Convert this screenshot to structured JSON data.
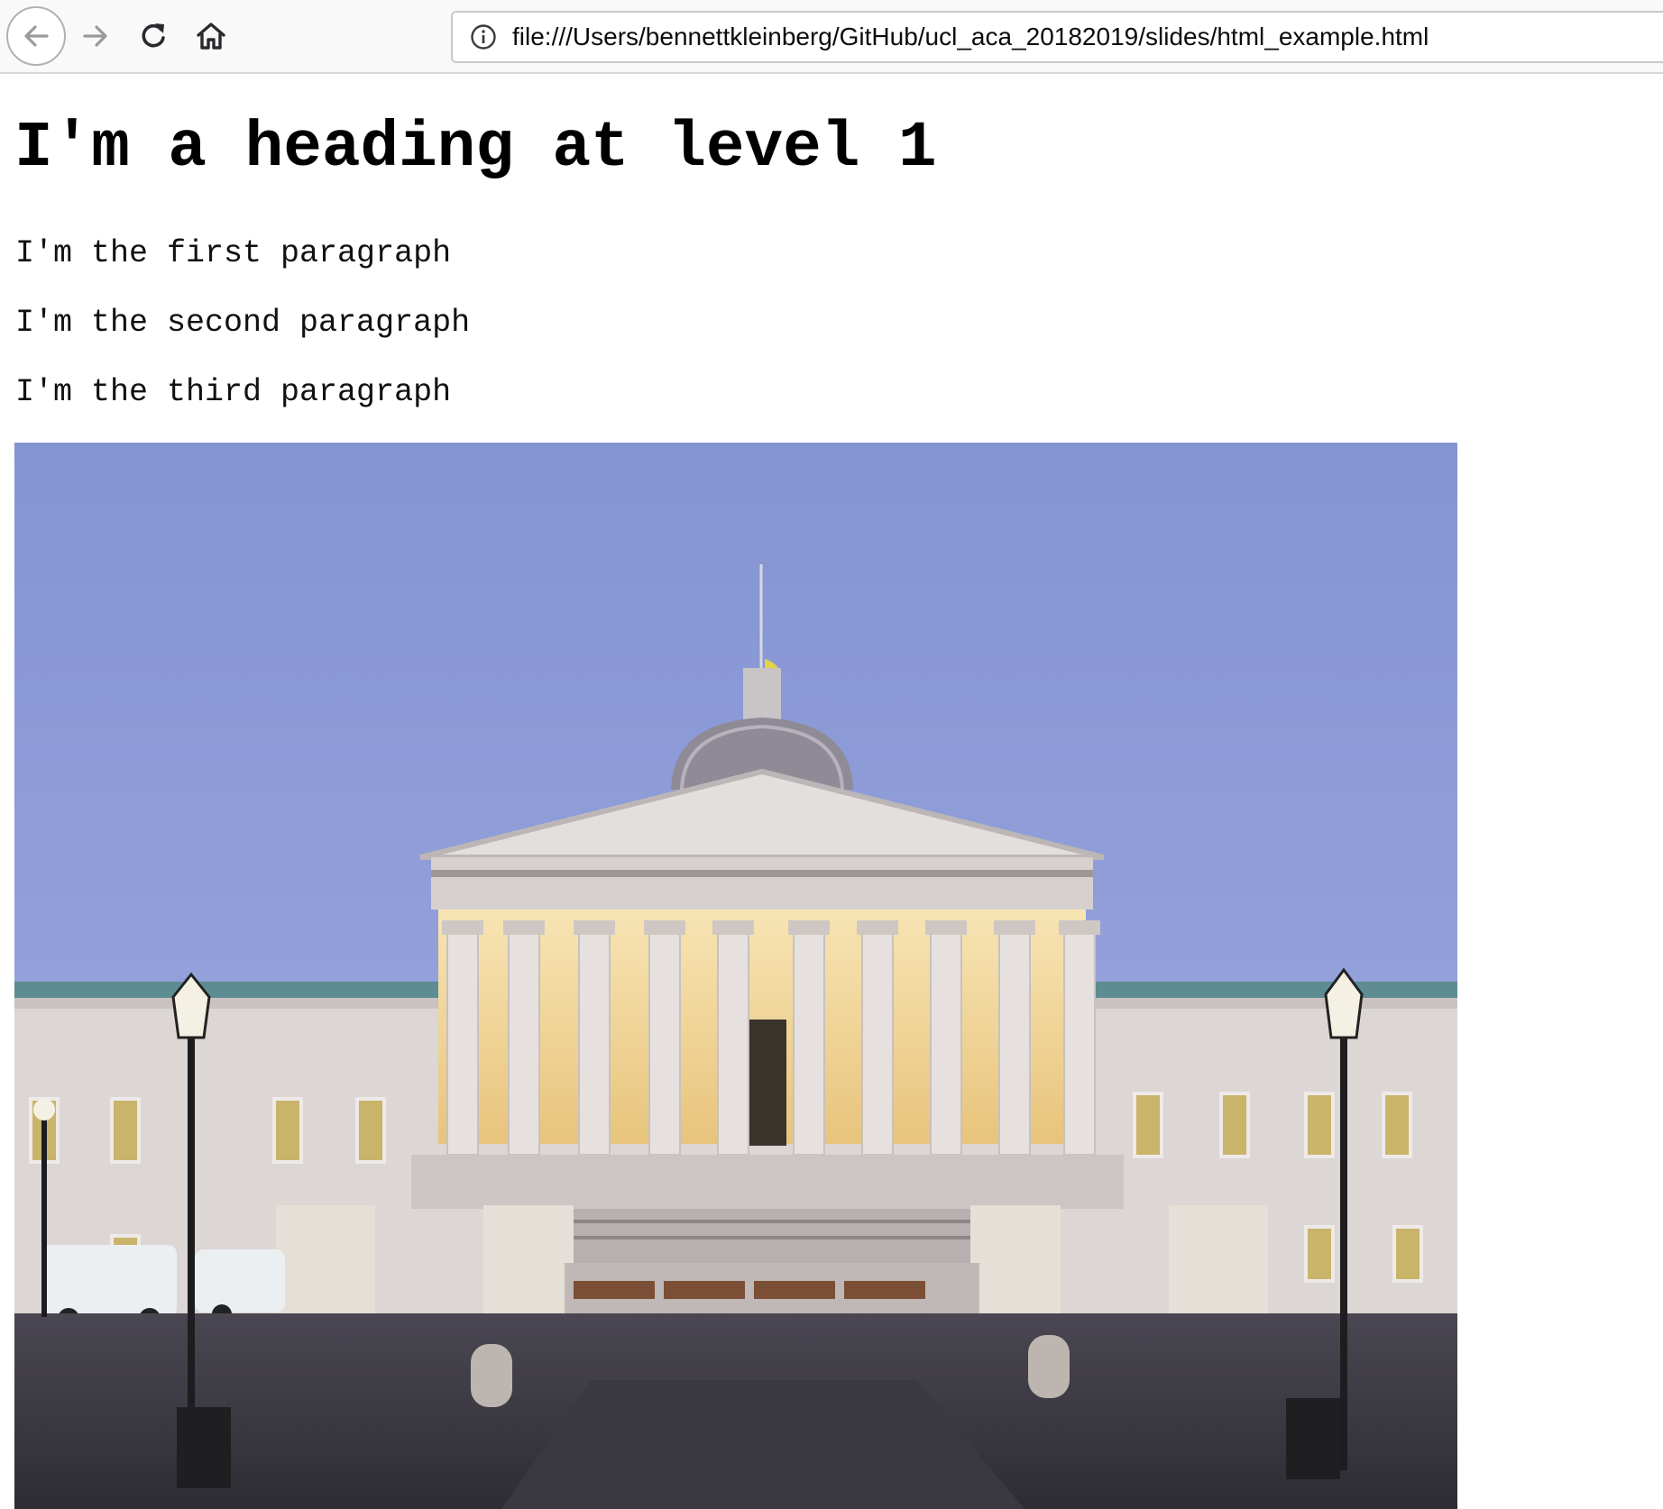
{
  "browser": {
    "url": "file:///Users/bennettkleinberg/GitHub/ucl_aca_20182019/slides/html_example.html",
    "icons": {
      "back": "arrow-left-icon",
      "forward": "arrow-right-icon",
      "reload": "reload-icon",
      "home": "home-icon",
      "site_info": "info-icon"
    }
  },
  "page": {
    "heading": "I'm a heading at level 1",
    "paragraphs": [
      "I'm the first paragraph",
      "I'm the second paragraph",
      "I'm the third paragraph"
    ],
    "image": {
      "subject": "neoclassical portico building with dome at dusk"
    }
  },
  "colors": {
    "sky": "#8f9dd8",
    "portico_glow": "#f2d9a0",
    "stone": "#dcd8d6"
  }
}
